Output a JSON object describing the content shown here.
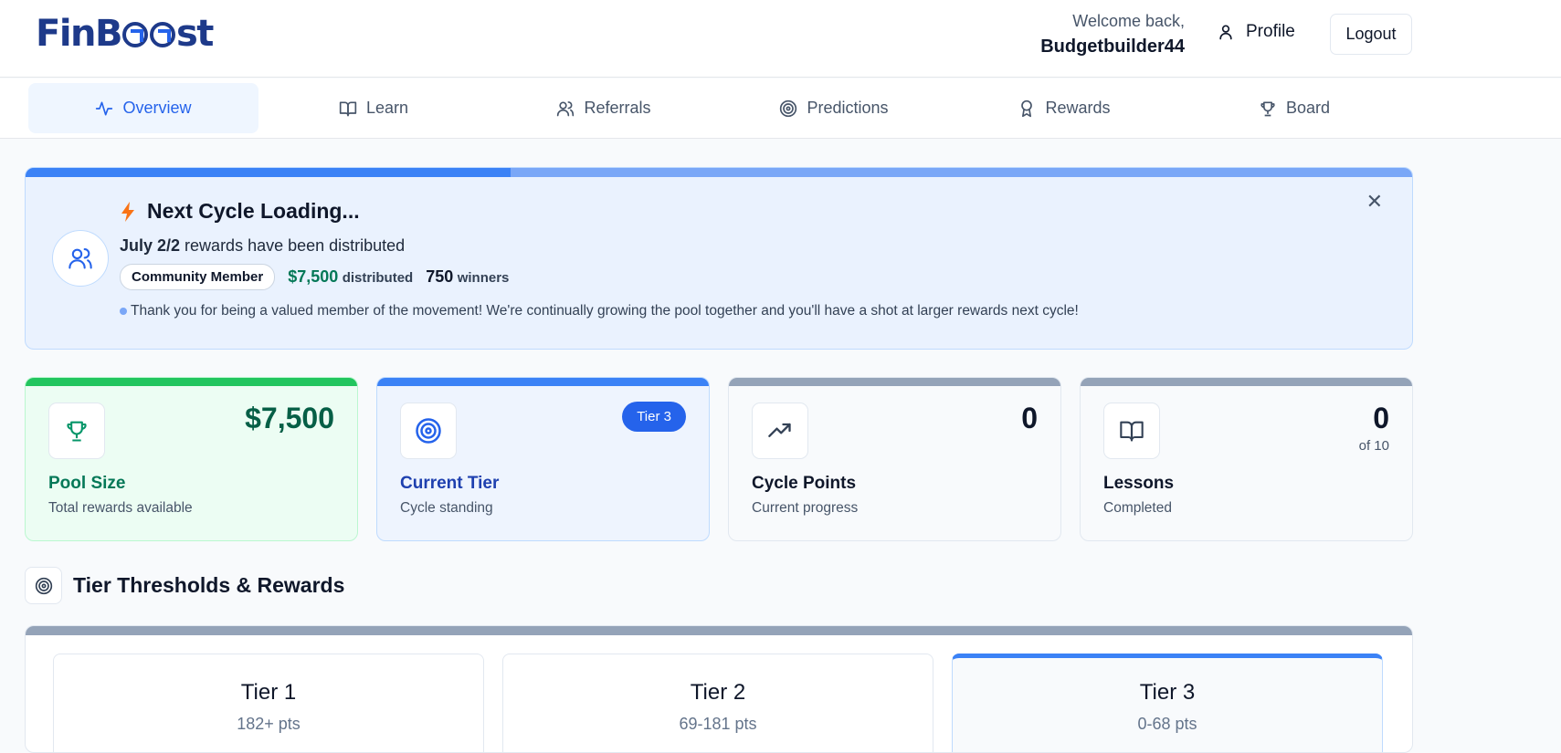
{
  "brand": {
    "name_part1": "FinB",
    "name_part2": "st"
  },
  "header": {
    "welcome": "Welcome back,",
    "username": "Budgetbuilder44",
    "profile_label": "Profile",
    "logout_label": "Logout"
  },
  "nav": {
    "tabs": [
      {
        "label": "Overview",
        "icon": "activity-icon",
        "active": true
      },
      {
        "label": "Learn",
        "icon": "book-icon",
        "active": false
      },
      {
        "label": "Referrals",
        "icon": "users-icon",
        "active": false
      },
      {
        "label": "Predictions",
        "icon": "target-icon",
        "active": false
      },
      {
        "label": "Rewards",
        "icon": "award-icon",
        "active": false
      },
      {
        "label": "Board",
        "icon": "trophy-icon",
        "active": false
      }
    ]
  },
  "banner": {
    "title": "Next Cycle Loading...",
    "cycle": "July 2/2",
    "cycle_suffix": " rewards have been distributed",
    "badge": "Community Member",
    "distributed_amount": "$7,500",
    "distributed_label": "distributed",
    "winners_count": "750",
    "winners_label": "winners",
    "note": "Thank you for being a valued member of the movement! We're continually growing the pool together and you'll have a shot at larger rewards next cycle!",
    "progress": 0.35
  },
  "stats": [
    {
      "label": "Pool Size",
      "desc": "Total rewards available",
      "value": "$7,500",
      "icon": "trophy-icon"
    },
    {
      "label": "Current Tier",
      "desc": "Cycle standing",
      "badge": "Tier 3",
      "icon": "target-icon"
    },
    {
      "label": "Cycle Points",
      "desc": "Current progress",
      "value": "0",
      "icon": "trending-up-icon"
    },
    {
      "label": "Lessons",
      "desc": "Completed",
      "value": "0",
      "sub": "of 10",
      "icon": "book-icon"
    }
  ],
  "tiers_section": {
    "title": "Tier Thresholds & Rewards",
    "tiers": [
      {
        "name": "Tier 1",
        "pts": "182+ pts"
      },
      {
        "name": "Tier 2",
        "pts": "69-181 pts"
      },
      {
        "name": "Tier 3",
        "pts": "0-68 pts"
      }
    ]
  },
  "colors": {
    "accent": "#2563eb",
    "success": "#047857",
    "banner_bg": "#eaf2fe"
  }
}
